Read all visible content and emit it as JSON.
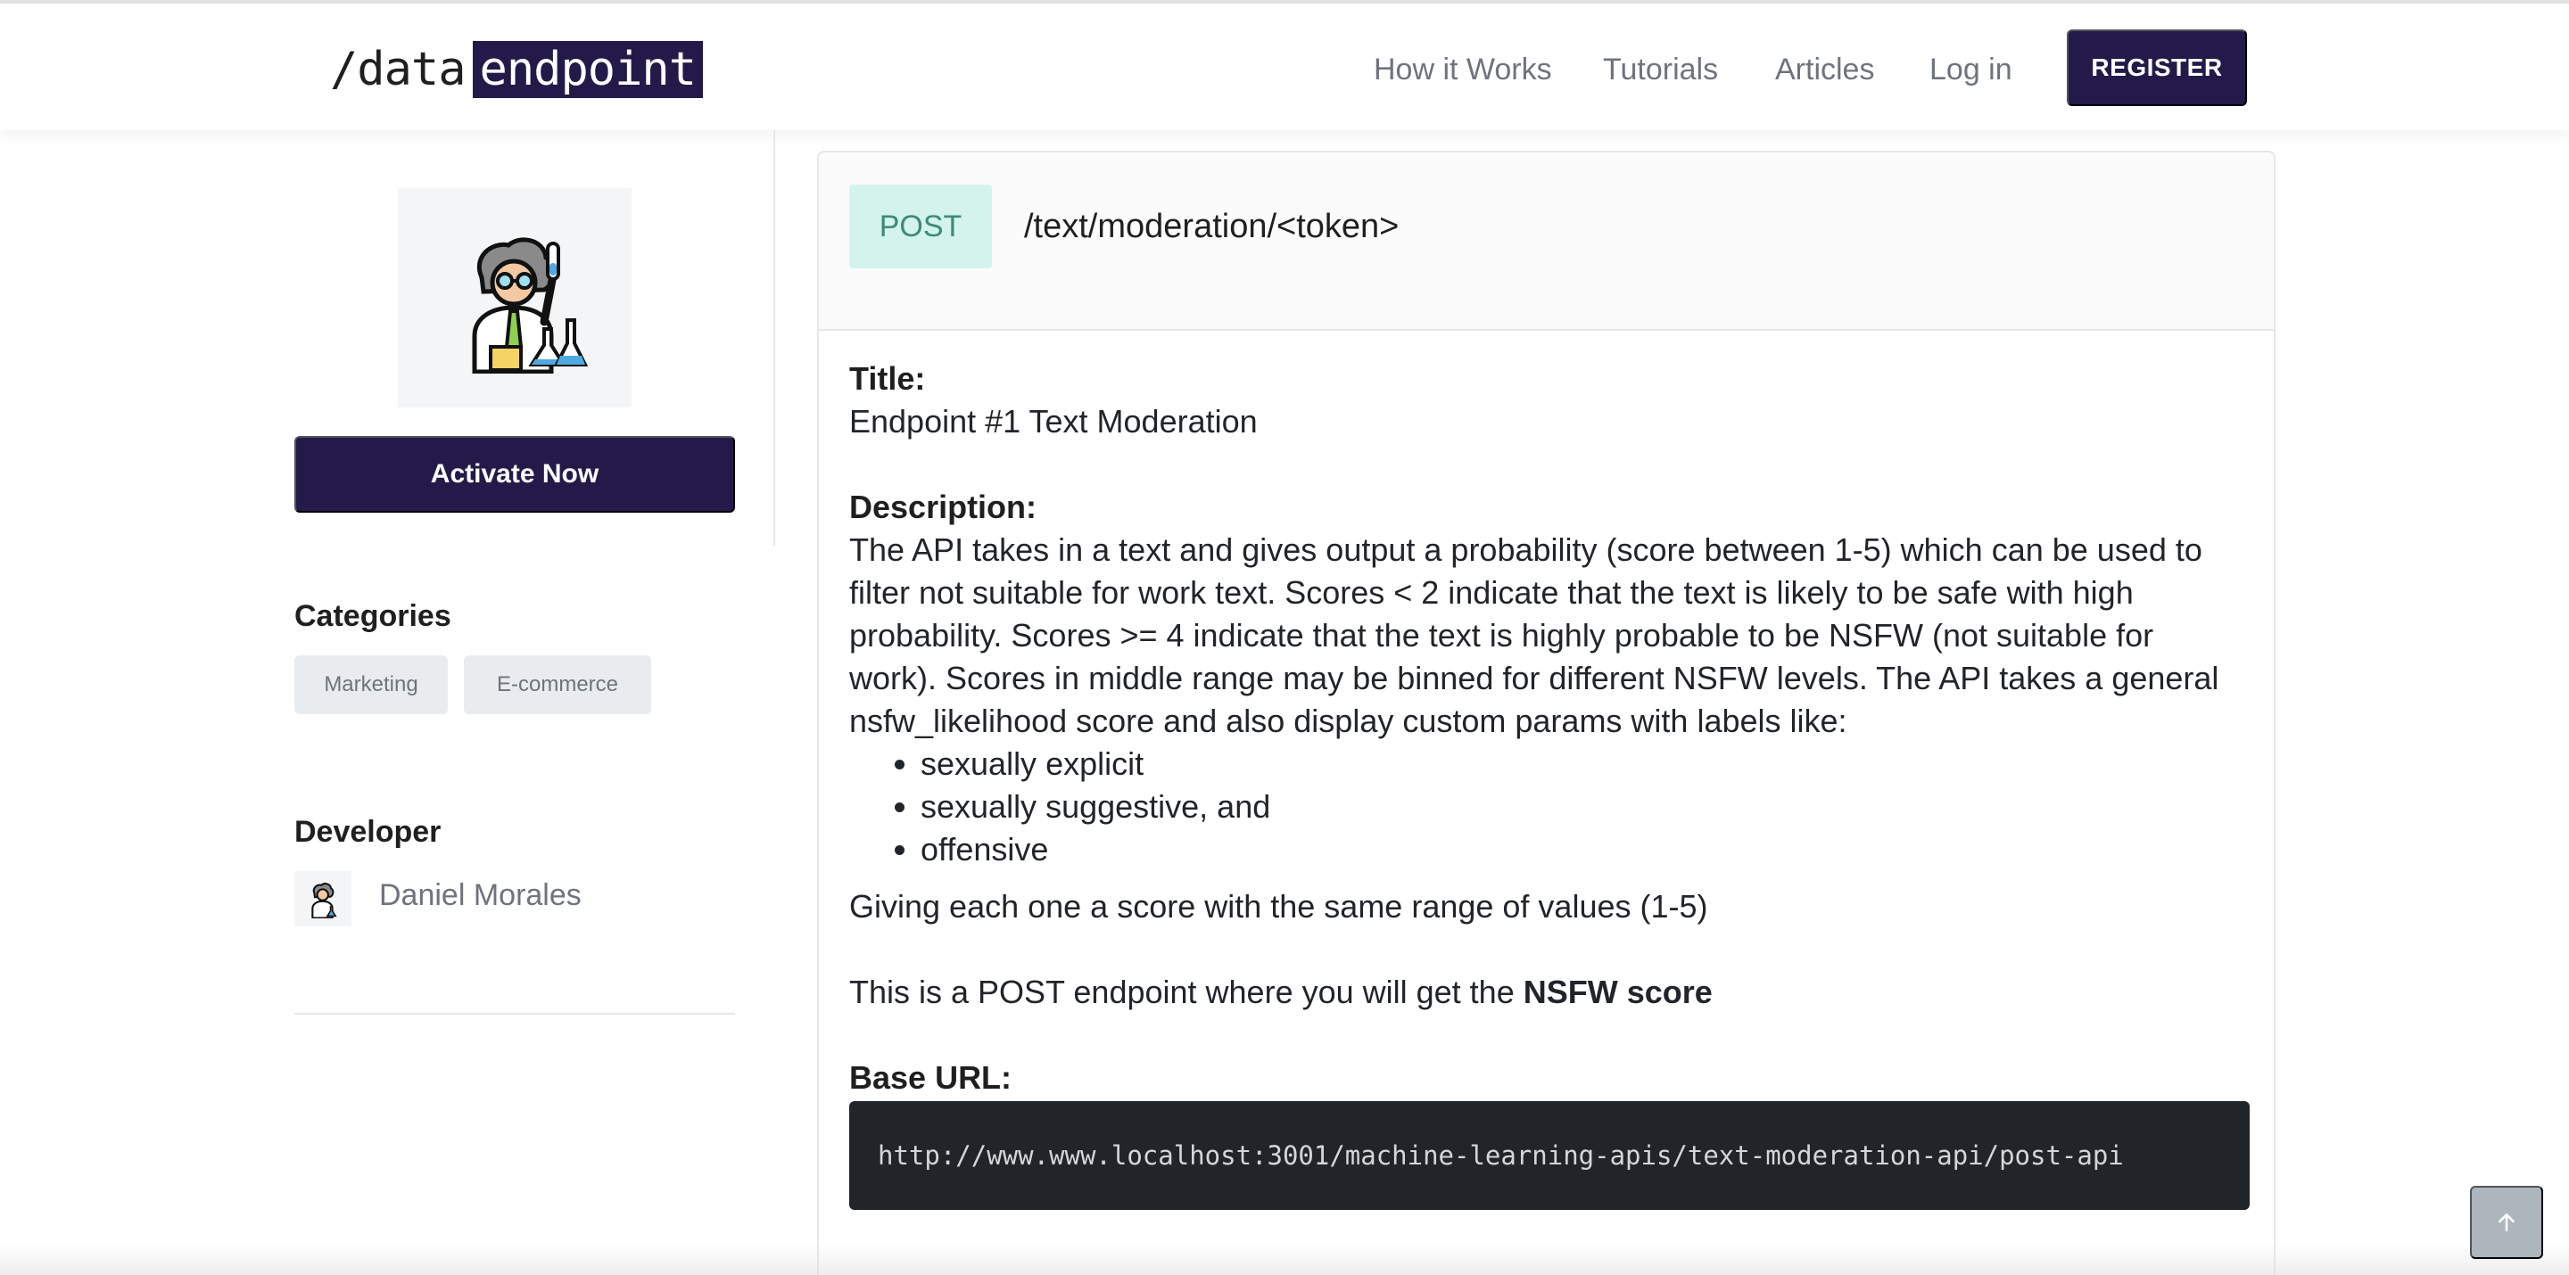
{
  "header": {
    "logo_prefix": "/data",
    "logo_highlight": "endpoint",
    "nav": {
      "how_it_works": "How it Works",
      "tutorials": "Tutorials",
      "articles": "Articles",
      "log_in": "Log in"
    },
    "register_label": "REGISTER"
  },
  "sidebar": {
    "activate_label": "Activate Now",
    "categories_heading": "Categories",
    "categories": [
      "Marketing",
      "E-commerce"
    ],
    "developer_heading": "Developer",
    "developer_name": "Daniel Morales"
  },
  "endpoint": {
    "method": "POST",
    "path": "/text/moderation/<token>",
    "title_label": "Title:",
    "title": "Endpoint #1 Text Moderation",
    "description_label": "Description:",
    "description": "The API takes in a text and gives output a probability (score between 1-5) which can be used to filter not suitable for work text. Scores < 2 indicate that the text is likely to be safe with high probability. Scores >= 4 indicate that the text is highly probable to be NSFW (not suitable for work). Scores in middle range may be binned for different NSFW levels. The API takes a general nsfw_likelihood score and also display custom params with labels like:",
    "bullets": [
      "sexually explicit",
      "sexually suggestive, and",
      "offensive"
    ],
    "giving_text": "Giving each one a score with the same range of values (1-5)",
    "post_text_prefix": "This is a POST endpoint where you will get the",
    "post_text_bold": "NSFW score",
    "base_url_label": "Base URL:",
    "base_url": "http://www.www.localhost:3001/machine-learning-apis/text-moderation-api/post-api"
  },
  "icons": {
    "avatar": "scientist-avatar-icon",
    "scroll_top": "arrow-up-icon"
  },
  "colors": {
    "brand": "#241a4a",
    "method_bg": "#d3f3ec",
    "method_text": "#3c8a7c",
    "code_bg": "#212529"
  }
}
